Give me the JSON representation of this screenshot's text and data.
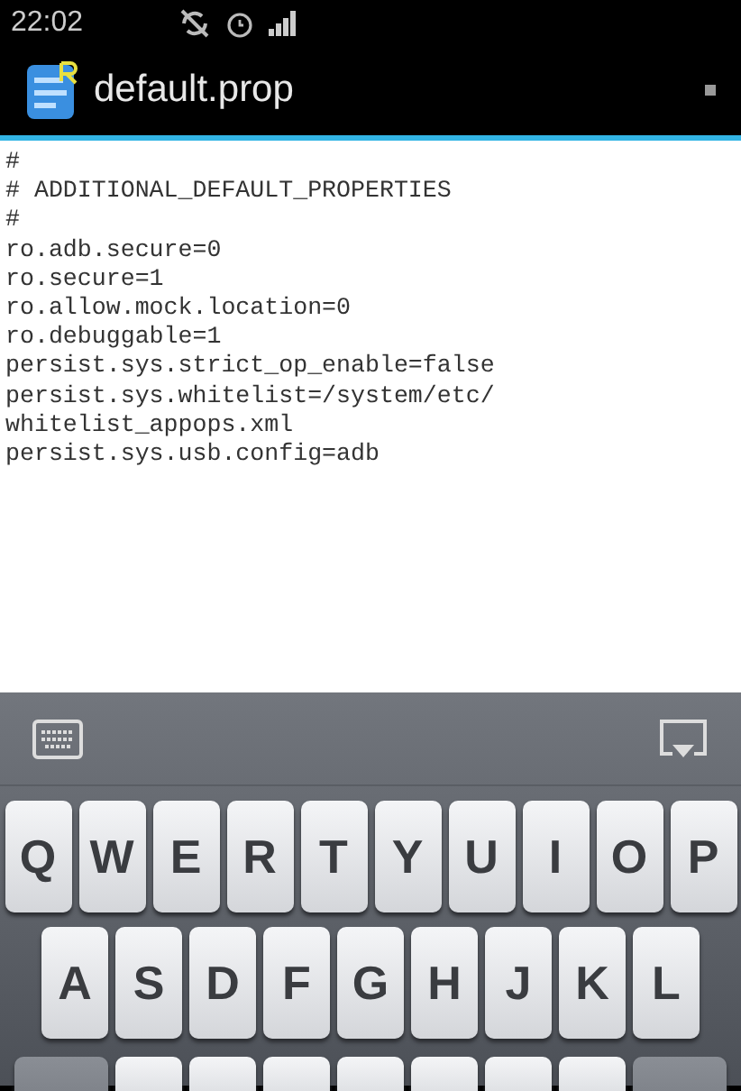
{
  "status_bar": {
    "time": "22:02"
  },
  "title_bar": {
    "title": "default.prop"
  },
  "editor": {
    "lines": [
      "#",
      "# ADDITIONAL_DEFAULT_PROPERTIES",
      "#",
      "ro.adb.secure=0",
      "ro.secure=1",
      "ro.allow.mock.location=0",
      "ro.debuggable=1",
      "persist.sys.strict_op_enable=false",
      "persist.sys.whitelist=/system/etc/",
      "whitelist_appops.xml",
      "persist.sys.usb.config=adb"
    ]
  },
  "keyboard": {
    "rows": [
      [
        "Q",
        "W",
        "E",
        "R",
        "T",
        "Y",
        "U",
        "I",
        "O",
        "P"
      ],
      [
        "A",
        "S",
        "D",
        "F",
        "G",
        "H",
        "J",
        "K",
        "L"
      ]
    ]
  }
}
